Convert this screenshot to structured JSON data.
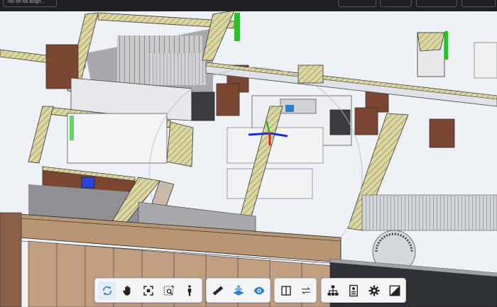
{
  "topbar": {
    "assignment_text": "No se ha asign..."
  },
  "toolbar": {
    "navigation": [
      {
        "icon": "orbit-icon",
        "active": true
      },
      {
        "icon": "pan-hand-icon",
        "active": false
      },
      {
        "icon": "fit-view-icon",
        "active": false
      },
      {
        "icon": "zoom-window-icon",
        "active": false
      },
      {
        "icon": "walk-person-icon",
        "active": false
      }
    ],
    "tools": [
      {
        "icon": "measure-ruler-icon",
        "active": false
      },
      {
        "icon": "section-plane-icon",
        "active": false
      },
      {
        "icon": "view-eye-icon",
        "active": false
      }
    ],
    "compare": [
      {
        "icon": "split-view-icon",
        "active": false
      },
      {
        "icon": "swap-arrows-icon",
        "active": false
      }
    ],
    "model": [
      {
        "icon": "model-tree-icon",
        "active": false
      },
      {
        "icon": "properties-icon",
        "active": false
      },
      {
        "icon": "settings-gear-icon",
        "active": false
      },
      {
        "icon": "fullscreen-icon",
        "active": false
      }
    ]
  },
  "colors": {
    "accent": "#2f80c8",
    "wall_hatch": "#d9d39b",
    "wood_panel": "#7b4632",
    "floor": "#f1f3f6"
  }
}
